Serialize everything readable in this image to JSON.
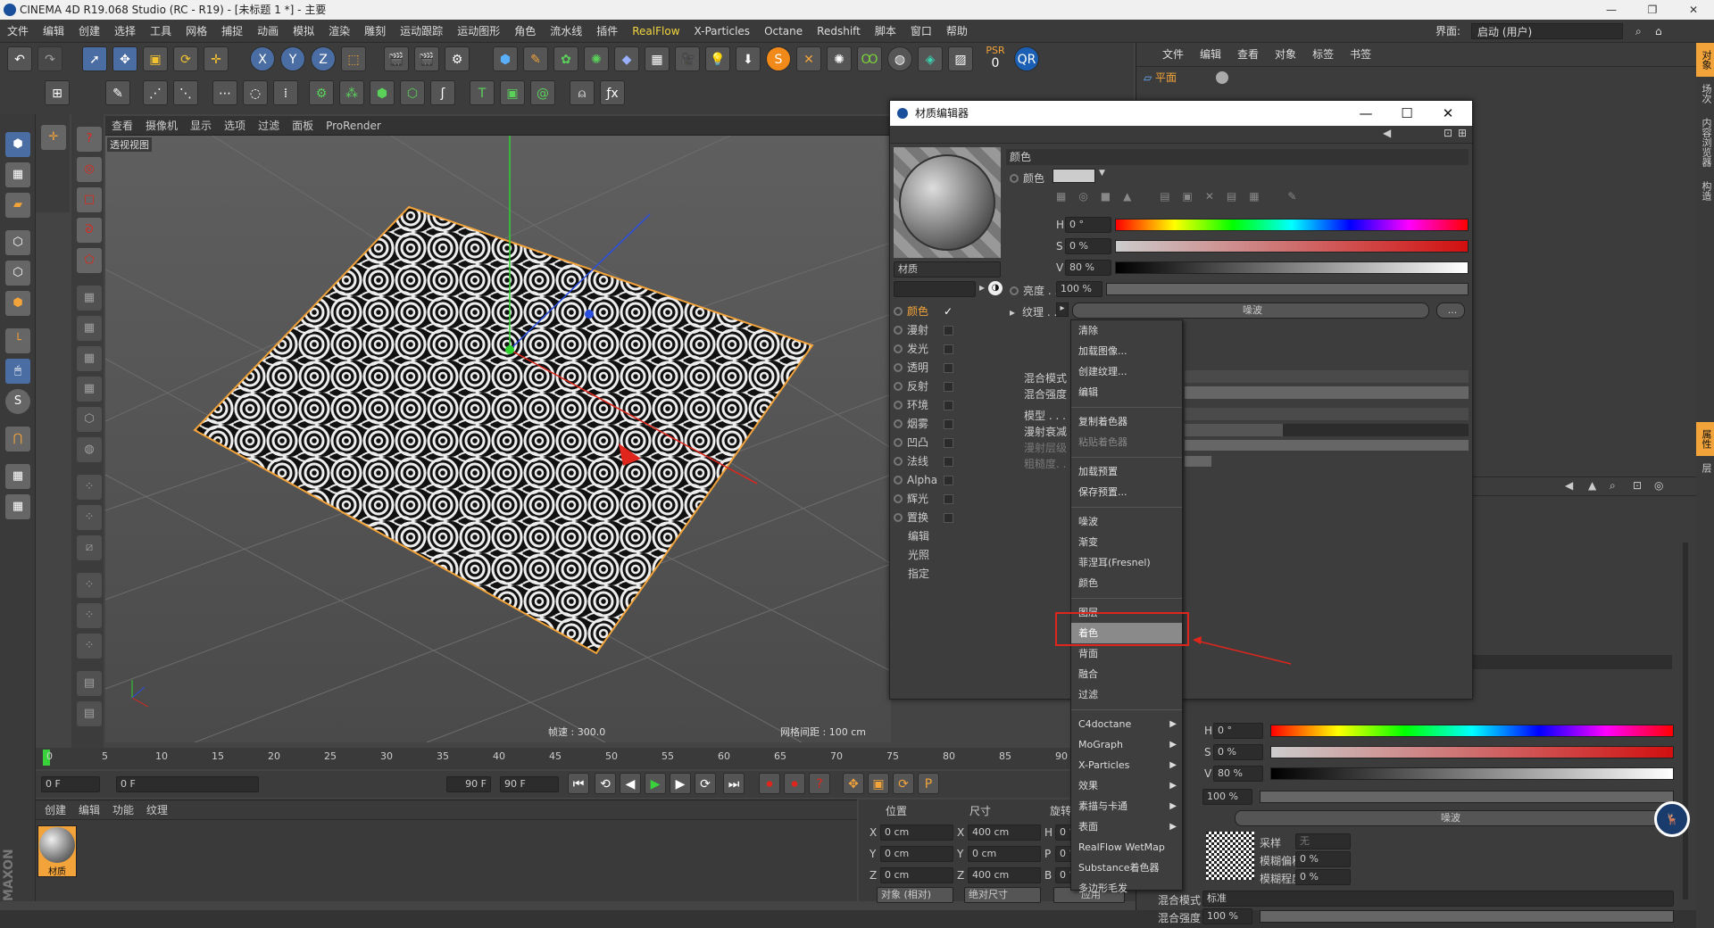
{
  "title": "CINEMA 4D R19.068 Studio (RC - R19) - [未标题 1 *] - 主要",
  "menubar": [
    "文件",
    "编辑",
    "创建",
    "选择",
    "工具",
    "网格",
    "捕捉",
    "动画",
    "模拟",
    "渲染",
    "雕刻",
    "运动跟踪",
    "运动图形",
    "角色",
    "流水线",
    "插件",
    "RealFlow",
    "X-Particles",
    "Octane",
    "Redshift",
    "脚本",
    "窗口",
    "帮助"
  ],
  "layout_label": "界面:",
  "layout_value": "启动 (用户)",
  "psr": {
    "label": "PSR",
    "value": "0"
  },
  "viewport": {
    "menu": [
      "查看",
      "摄像机",
      "显示",
      "选项",
      "过滤",
      "面板",
      "ProRender"
    ],
    "name": "透视视图",
    "fps": "帧速 : 300.0",
    "grid": "网格间距 : 100 cm"
  },
  "timeline": {
    "ticks": [
      "0",
      "5",
      "10",
      "15",
      "20",
      "25",
      "30",
      "35",
      "40",
      "45",
      "50",
      "55",
      "60",
      "65",
      "70",
      "75",
      "80",
      "85",
      "90"
    ],
    "start": "0 F",
    "range_start": "0 F",
    "range_end": "90 F",
    "end": "90 F"
  },
  "material_manager": {
    "menu": [
      "创建",
      "编辑",
      "功能",
      "纹理"
    ],
    "material_name": "材质"
  },
  "coordinates": {
    "headers": [
      "位置",
      "尺寸",
      "旋转"
    ],
    "rows": [
      {
        "axis": "X",
        "pos": "0 cm",
        "size_axis": "X",
        "size": "400 cm",
        "rot_axis": "H",
        "rot": "0 °"
      },
      {
        "axis": "Y",
        "pos": "0 cm",
        "size_axis": "Y",
        "size": "0 cm",
        "rot_axis": "P",
        "rot": "0 °"
      },
      {
        "axis": "Z",
        "pos": "0 cm",
        "size_axis": "Z",
        "size": "400 cm",
        "rot_axis": "B",
        "rot": "0 °"
      }
    ],
    "mode1": "对象 (相对)",
    "mode2": "绝对尺寸",
    "apply": "应用"
  },
  "object_manager": {
    "menu": [
      "文件",
      "编辑",
      "查看",
      "对象",
      "标签",
      "书签"
    ],
    "object": "平面"
  },
  "side_tabs": [
    "对象",
    "场次",
    "内容浏览器",
    "构造",
    "属性",
    "层"
  ],
  "dialog": {
    "title": "材质编辑器",
    "preview_name": "材质",
    "channels": [
      {
        "label": "颜色",
        "checked": true
      },
      {
        "label": "漫射",
        "checked": false
      },
      {
        "label": "发光",
        "checked": false
      },
      {
        "label": "透明",
        "checked": false
      },
      {
        "label": "反射",
        "checked": false
      },
      {
        "label": "环境",
        "checked": false
      },
      {
        "label": "烟雾",
        "checked": false
      },
      {
        "label": "凹凸",
        "checked": false
      },
      {
        "label": "法线",
        "checked": false
      },
      {
        "label": "Alpha",
        "checked": false
      },
      {
        "label": "辉光",
        "checked": false
      },
      {
        "label": "置换",
        "checked": false
      }
    ],
    "extras": [
      "编辑",
      "光照",
      "指定"
    ],
    "section": "颜色",
    "color_label": "颜色",
    "h_label": "H",
    "h_value": "0 °",
    "s_label": "S",
    "s_value": "0 %",
    "v_label": "V",
    "v_value": "80 %",
    "brightness_label": "亮度 . . .",
    "brightness_value": "100 %",
    "texture_label": "纹理 . . .",
    "texture_value": "噪波",
    "mix_mode_label": "混合模式",
    "mix_strength_label": "混合强度",
    "model_label": "模型 . . .",
    "diffuse_falloff_label": "漫射衰减",
    "diffuse_level_label": "漫射层级",
    "roughness_label": "粗糙度. . ."
  },
  "context_menu": {
    "groups": [
      [
        "清除",
        "加载图像...",
        "创建纹理...",
        "编辑"
      ],
      [
        "复制着色器",
        "粘贴着色器"
      ],
      [
        "加载预置",
        "保存预置..."
      ],
      [
        "噪波",
        "渐变",
        "菲涅耳(Fresnel)",
        "颜色"
      ],
      [
        "图层",
        "着色",
        "背面",
        "融合",
        "过滤"
      ],
      [
        "C4doctane",
        "MoGraph",
        "X-Particles",
        "效果",
        "素描与卡通",
        "表面",
        "RealFlow WetMap",
        "Substance着色器",
        "多边形毛发"
      ]
    ],
    "submenus": [
      "C4doctane",
      "MoGraph",
      "X-Particles",
      "效果",
      "素描与卡通",
      "表面"
    ],
    "highlighted": "着色"
  },
  "attributes": {
    "h_value": "0 °",
    "s_value": "0 %",
    "v_value": "80 %",
    "brightness": "100 %",
    "texture": "噪波",
    "sampling_label": "采样",
    "sampling_value": "无",
    "blur_offset_label": "模糊偏移",
    "blur_offset": "0 %",
    "blur_scale_label": "模糊程度",
    "blur_scale": "0 %",
    "mix_mode_label": "混合模式",
    "mix_mode": "标准",
    "mix_strength_label": "混合强度",
    "mix_strength": "100 %"
  },
  "colors": {
    "accent": "#f2a33a",
    "highlight_box": "#e0261c",
    "hue_bar": "rainbow"
  }
}
